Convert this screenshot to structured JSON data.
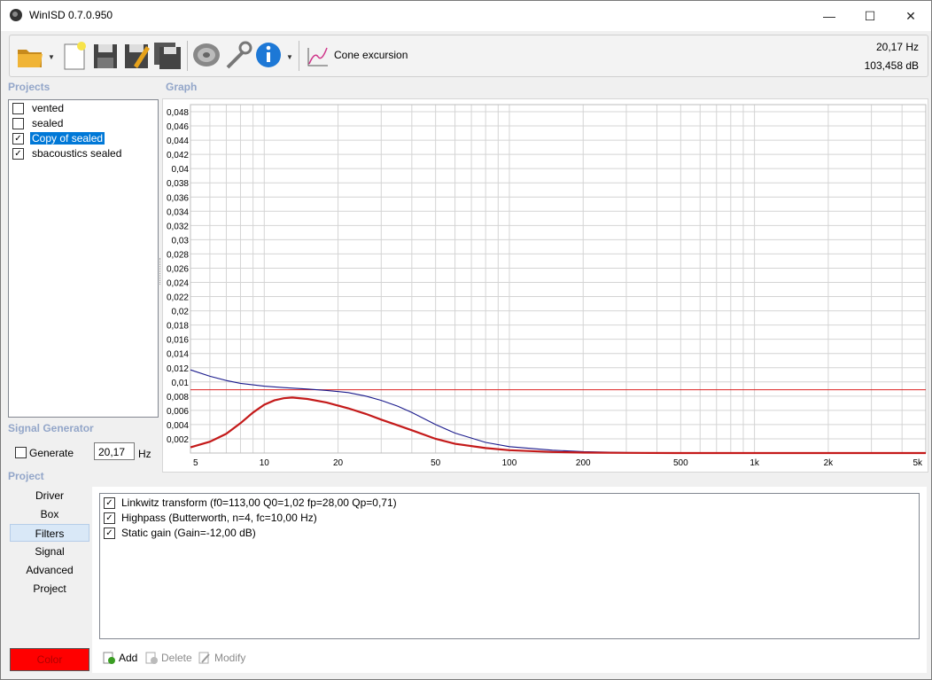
{
  "window": {
    "title": "WinISD 0.7.0.950"
  },
  "toolbar": {
    "buttons": [
      {
        "name": "open-folder-icon"
      },
      {
        "name": "new-project-icon"
      },
      {
        "name": "save-icon"
      },
      {
        "name": "save-as-icon"
      },
      {
        "name": "save-all-icon"
      },
      {
        "name": "driver-editor-icon"
      },
      {
        "name": "tools-icon"
      },
      {
        "name": "info-icon"
      }
    ],
    "graph_selector_label": "Cone excursion",
    "readout_hz": "20,17 Hz",
    "readout_db": "103,458 dB"
  },
  "projects": {
    "section_label": "Projects",
    "items": [
      {
        "label": "vented",
        "checked": false,
        "selected": false
      },
      {
        "label": "sealed",
        "checked": false,
        "selected": false
      },
      {
        "label": "Copy of sealed",
        "checked": true,
        "selected": true
      },
      {
        "label": "sbacoustics sealed",
        "checked": true,
        "selected": false
      }
    ]
  },
  "graph": {
    "section_label": "Graph"
  },
  "chart_data": {
    "type": "line",
    "x_scale": "log",
    "xlim": [
      5,
      5000
    ],
    "ylim": [
      0,
      0.049
    ],
    "x_ticks": [
      {
        "value": 5,
        "label": "5"
      },
      {
        "value": 10,
        "label": "10"
      },
      {
        "value": 20,
        "label": "20"
      },
      {
        "value": 50,
        "label": "50"
      },
      {
        "value": 100,
        "label": "100"
      },
      {
        "value": 200,
        "label": "200"
      },
      {
        "value": 500,
        "label": "500"
      },
      {
        "value": 1000,
        "label": "1k"
      },
      {
        "value": 2000,
        "label": "2k"
      },
      {
        "value": 5000,
        "label": "5k"
      }
    ],
    "y_ticks": [
      "0,002",
      "0,004",
      "0,006",
      "0,008",
      "0,01",
      "0,012",
      "0,014",
      "0,016",
      "0,018",
      "0,02",
      "0,022",
      "0,024",
      "0,026",
      "0,028",
      "0,03",
      "0,032",
      "0,034",
      "0,036",
      "0,038",
      "0,04",
      "0,042",
      "0,044",
      "0,046",
      "0,048"
    ],
    "y_tick_values": [
      0.002,
      0.004,
      0.006,
      0.008,
      0.01,
      0.012,
      0.014,
      0.016,
      0.018,
      0.02,
      0.022,
      0.024,
      0.026,
      0.028,
      0.03,
      0.032,
      0.034,
      0.036,
      0.038,
      0.04,
      0.042,
      0.044,
      0.046,
      0.048
    ],
    "grid": true,
    "limit_line": {
      "y": 0.0089,
      "color": "#dd2222"
    },
    "series": [
      {
        "color": "#1a1a8c",
        "points": [
          [
            5,
            0.0117
          ],
          [
            6,
            0.0108
          ],
          [
            7,
            0.0102
          ],
          [
            8,
            0.0098
          ],
          [
            10,
            0.0094
          ],
          [
            12,
            0.0092
          ],
          [
            15,
            0.009
          ],
          [
            18,
            0.0088
          ],
          [
            22,
            0.0085
          ],
          [
            26,
            0.008
          ],
          [
            30,
            0.0074
          ],
          [
            35,
            0.0066
          ],
          [
            40,
            0.0057
          ],
          [
            50,
            0.004
          ],
          [
            60,
            0.0028
          ],
          [
            80,
            0.0015
          ],
          [
            100,
            0.0009
          ],
          [
            150,
            0.0004
          ],
          [
            200,
            0.0002
          ],
          [
            300,
            7e-05
          ],
          [
            500,
            2e-05
          ],
          [
            1000,
            5e-06
          ],
          [
            5000,
            0.0
          ]
        ]
      },
      {
        "color": "#c41a1a",
        "points": [
          [
            5,
            0.0008
          ],
          [
            6,
            0.0016
          ],
          [
            7,
            0.0027
          ],
          [
            8,
            0.0042
          ],
          [
            9,
            0.0057
          ],
          [
            10,
            0.0068
          ],
          [
            11,
            0.0074
          ],
          [
            12,
            0.0077
          ],
          [
            13,
            0.0078
          ],
          [
            15,
            0.0076
          ],
          [
            18,
            0.0071
          ],
          [
            22,
            0.0063
          ],
          [
            26,
            0.0055
          ],
          [
            30,
            0.0047
          ],
          [
            35,
            0.0039
          ],
          [
            40,
            0.0032
          ],
          [
            50,
            0.002
          ],
          [
            60,
            0.0013
          ],
          [
            80,
            0.0007
          ],
          [
            100,
            0.0004
          ],
          [
            150,
            0.00015
          ],
          [
            200,
            6e-05
          ],
          [
            300,
            2e-05
          ],
          [
            500,
            5e-06
          ],
          [
            5000,
            0.0
          ]
        ]
      }
    ]
  },
  "signal_generator": {
    "section_label": "Signal Generator",
    "generate_label": "Generate",
    "generate_checked": false,
    "frequency_value": "20,17",
    "unit": "Hz"
  },
  "project_nav": {
    "section_label": "Project",
    "items": [
      {
        "label": "Driver",
        "active": false
      },
      {
        "label": "Box",
        "active": false
      },
      {
        "label": "Filters",
        "active": true
      },
      {
        "label": "Signal",
        "active": false
      },
      {
        "label": "Advanced",
        "active": false
      },
      {
        "label": "Project",
        "active": false
      }
    ],
    "color_button_label": "Color",
    "color_value": "#ff0000"
  },
  "filters": {
    "items": [
      {
        "label": "Linkwitz transform (f0=113,00 Q0=1,02 fp=28,00 Qp=0,71)",
        "checked": true
      },
      {
        "label": "Highpass (Butterworth, n=4, fc=10,00 Hz)",
        "checked": true
      },
      {
        "label": "Static gain (Gain=-12,00 dB)",
        "checked": true
      }
    ],
    "actions": {
      "add_label": "Add",
      "delete_label": "Delete",
      "modify_label": "Modify"
    }
  }
}
